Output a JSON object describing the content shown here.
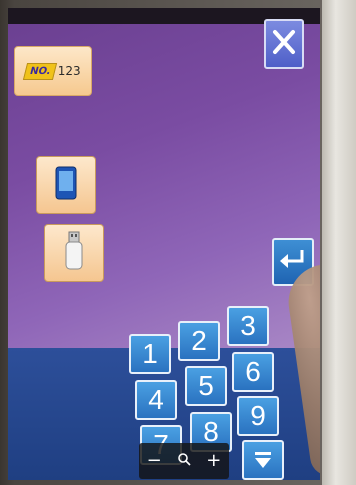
{
  "program": {
    "no_label": "NO.",
    "no_value": "123"
  },
  "buttons": {
    "close": "close-icon",
    "memory": "memory-chip-icon",
    "usb": "usb-drive-icon",
    "enter": "enter-return-icon"
  },
  "keypad": {
    "keys": [
      "1",
      "2",
      "3",
      "4",
      "5",
      "6",
      "7",
      "8",
      "9"
    ],
    "down_icon": "arrow-down-bar-icon"
  },
  "zoombar": {
    "minus": "−",
    "zoom": "search-icon",
    "plus": "+"
  },
  "colors": {
    "screen_purple": "#7a4ca2",
    "key_blue": "#2a72c0",
    "badge_orange": "#f6c98f",
    "close_blue": "#4f5fc8"
  }
}
